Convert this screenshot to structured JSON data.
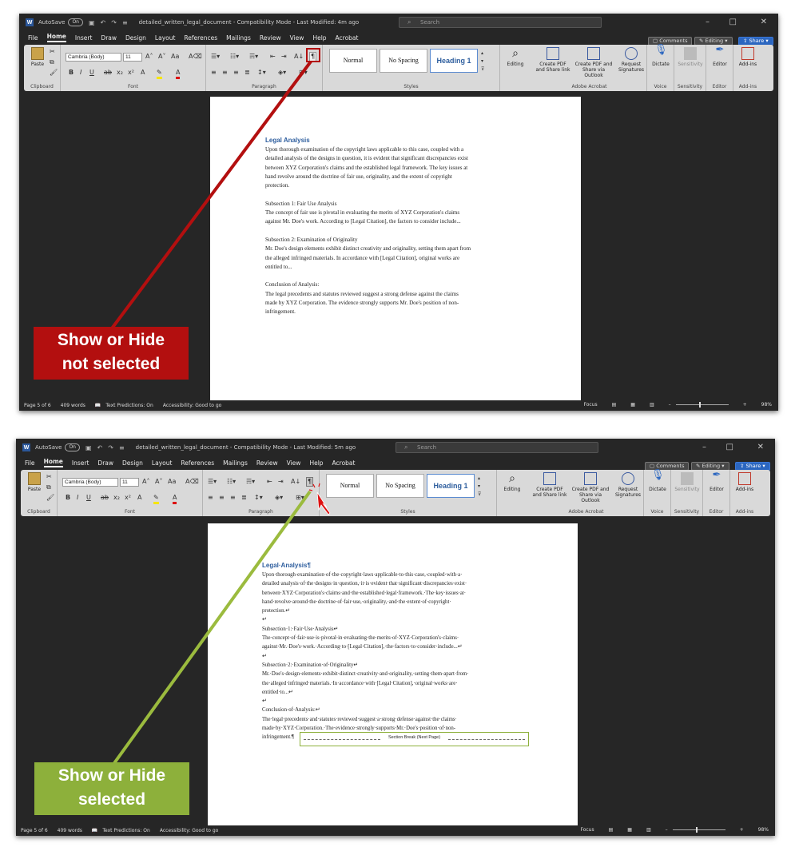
{
  "titlebar": {
    "autosave": "AutoSave",
    "autosave_state": "On",
    "title_1": "detailed_written_legal_document  -  Compatibility Mode  -  Last Modified: 4m ago",
    "title_2": "detailed_written_legal_document  -  Compatibility Mode  -  Last Modified: 5m ago",
    "search_placeholder": "Search"
  },
  "menu": [
    "File",
    "Home",
    "Insert",
    "Draw",
    "Design",
    "Layout",
    "References",
    "Mailings",
    "Review",
    "View",
    "Help",
    "Acrobat"
  ],
  "right_buttons": {
    "comments": "Comments",
    "editing": "Editing",
    "share": "Share"
  },
  "ribbon": {
    "font_name": "Cambria (Body)",
    "font_size": "11",
    "paste": "Paste",
    "groups": {
      "clipboard": "Clipboard",
      "font": "Font",
      "paragraph": "Paragraph",
      "styles": "Styles",
      "adobe": "Adobe Acrobat",
      "voice": "Voice",
      "sensitivity": "Sensitivity",
      "editor": "Editor",
      "addins": "Add-ins"
    },
    "styles": [
      "Normal",
      "No Spacing",
      "Heading 1"
    ],
    "buttons": {
      "editing": "Editing",
      "pdf_link": "Create PDF and Share link",
      "pdf_outlook": "Create PDF and Share via Outlook",
      "request_sig": "Request Signatures",
      "dictate": "Dictate",
      "sensitivity": "Sensitivity",
      "editor": "Editor",
      "addins": "Add-ins"
    }
  },
  "status": {
    "page": "Page 5 of 6",
    "words": "409 words",
    "predictions": "Text Predictions: On",
    "accessibility": "Accessibility: Good to go",
    "focus": "Focus",
    "zoom": "98%"
  },
  "doc1": {
    "heading": "Legal Analysis",
    "p1": [
      "Upon thorough examination of the copyright laws applicable to this case, coupled with a",
      "detailed analysis of the designs in question, it is evident that significant discrepancies exist",
      "between XYZ Corporation's claims and the established legal framework. The key issues at",
      "hand revolve around the doctrine of fair use, originality, and the extent of copyright",
      "protection."
    ],
    "sub1": "Subsection 1: Fair Use Analysis",
    "p2": [
      "The concept of fair use is pivotal in evaluating the merits of XYZ Corporation's claims",
      "against Mr. Doe's work. According to [Legal Citation], the factors to consider include..."
    ],
    "sub2": "Subsection 2: Examination of Originality",
    "p3": [
      "Mr. Doe's design elements exhibit distinct creativity and originality, setting them apart from",
      "the alleged infringed materials. In accordance with [Legal Citation], original works are",
      "entitled to..."
    ],
    "sub3": "Conclusion of Analysis:",
    "p4": [
      "The legal precedents and statutes reviewed suggest a strong defense against the claims",
      "made by XYZ Corporation. The evidence strongly supports Mr. Doe's position of non-",
      "infringement."
    ]
  },
  "doc2": {
    "heading": "Legal·Analysis¶",
    "p1": [
      "Upon·thorough·examination·of·the·copyright·laws·applicable·to·this·case,·coupled·with·a·",
      "detailed·analysis·of·the·designs·in·question,·it·is·evident·that·significant·discrepancies·exist·",
      "between·XYZ·Corporation's·claims·and·the·established·legal·framework.·The·key·issues·at·",
      "hand·revolve·around·the·doctrine·of·fair·use,·originality,·and·the·extent·of·copyright·",
      "protection.↵"
    ],
    "b1": "↵",
    "sub1": "Subsection·1:·Fair·Use·Analysis↵",
    "p2": [
      "The·concept·of·fair·use·is·pivotal·in·evaluating·the·merits·of·XYZ·Corporation's·claims·",
      "against·Mr.·Doe's·work.·According·to·[Legal·Citation],·the·factors·to·consider·include...↵"
    ],
    "b2": "↵",
    "sub2": "Subsection·2:·Examination·of·Originality↵",
    "p3": [
      "Mr.·Doe's·design·elements·exhibit·distinct·creativity·and·originality,·setting·them·apart·from·",
      "the·alleged·infringed·materials.·In·accordance·with·[Legal·Citation],·original·works·are·",
      "entitled·to...↵"
    ],
    "b3": "↵",
    "sub3": "Conclusion·of·Analysis:↵",
    "p4": [
      "The·legal·precedents·and·statutes·reviewed·suggest·a·strong·defense·against·the·claims·",
      "made·by·XYZ·Corporation.·The·evidence·strongly·supports·Mr.·Doe's·position·of·non-"
    ],
    "last": "infringement.¶",
    "section_break": "Section Break (Next Page)"
  },
  "callouts": {
    "top_l1": "Show or Hide",
    "top_l2": "not selected",
    "bottom_l1": "Show or Hide",
    "bottom_l2": "selected"
  },
  "colors": {
    "red": "#b30f0f",
    "green": "#8db03b"
  }
}
